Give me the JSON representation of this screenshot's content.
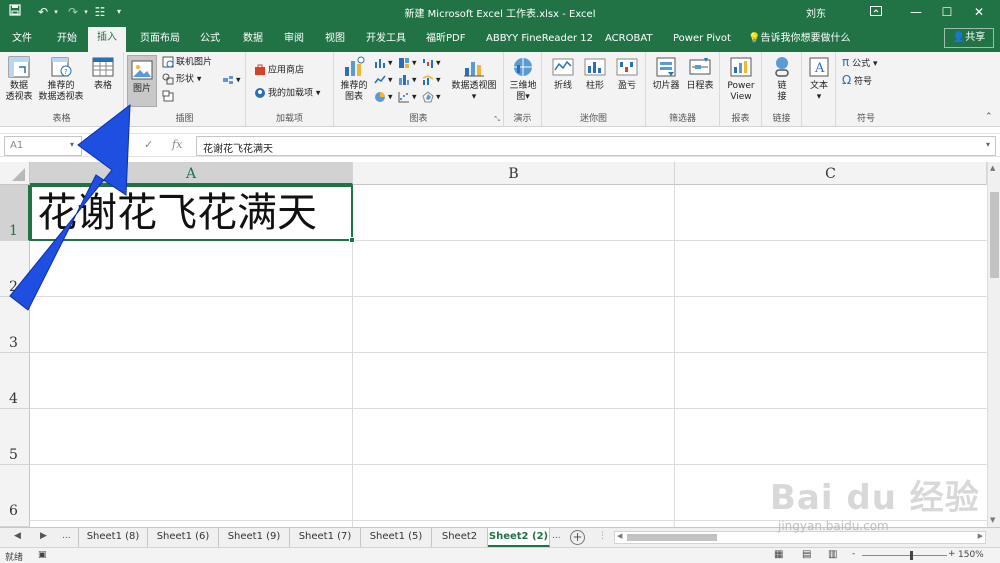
{
  "titlebar": {
    "save_icon": "save-icon",
    "undo_icon": "undo-icon",
    "redo_icon": "redo-icon",
    "title": "新建 Microsoft Excel 工作表.xlsx  -  Excel",
    "user": "刘东",
    "controls": [
      "ribbon-display-icon",
      "minimize-icon",
      "maximize-icon",
      "close-icon"
    ]
  },
  "tabs": [
    {
      "label": "文件"
    },
    {
      "label": "开始"
    },
    {
      "label": "插入",
      "active": true
    },
    {
      "label": "页面布局"
    },
    {
      "label": "公式"
    },
    {
      "label": "数据"
    },
    {
      "label": "审阅"
    },
    {
      "label": "视图"
    },
    {
      "label": "开发工具"
    },
    {
      "label": "福昕PDF"
    },
    {
      "label": "ABBYY FineReader 12"
    },
    {
      "label": "ACROBAT"
    },
    {
      "label": "Power Pivot"
    }
  ],
  "tell_me": "告诉我你想要做什么",
  "share": "共享",
  "ribbon": {
    "tables": {
      "label": "表格",
      "pivot": "数据\n透视表",
      "recommended_pivot": "推荐的\n数据透视表",
      "table": "表格"
    },
    "illustrations": {
      "label": "插图",
      "picture": "图片",
      "online_picture": "联机图片",
      "shapes": "形状"
    },
    "addins": {
      "label": "加载项",
      "store": "应用商店",
      "my_addins": "我的加载项"
    },
    "charts": {
      "label": "图表",
      "recommended": "推荐的\n图表",
      "pivot_chart": "数据透视图"
    },
    "tours": {
      "label": "演示",
      "map3d": "三维地\n图"
    },
    "sparklines": {
      "label": "迷你图",
      "line": "折线",
      "column": "柱形",
      "winloss": "盈亏"
    },
    "filters": {
      "label": "筛选器",
      "slicer": "切片器",
      "timeline": "日程表"
    },
    "reports": {
      "label": "报表",
      "powerview": "Power\nView"
    },
    "links": {
      "label": "链接",
      "link": "链\n接"
    },
    "text": {
      "label": "",
      "text": "文本"
    },
    "symbols": {
      "label": "符号",
      "equation": "公式",
      "symbol": "符号",
      "pi": "π",
      "omega": "Ω"
    }
  },
  "formula_bar": {
    "name_box": "A1",
    "cancel": "✕",
    "enter": "✓",
    "fx": "fx",
    "value": "花谢花飞花满天"
  },
  "grid": {
    "columns": [
      "A",
      "B",
      "C"
    ],
    "rows": [
      "1",
      "2",
      "3",
      "4",
      "5",
      "6"
    ],
    "a1": "花谢花飞花满天"
  },
  "sheets": {
    "ellipsis_left": "...",
    "tabs": [
      "Sheet1 (8)",
      "Sheet1 (6)",
      "Sheet1 (9)",
      "Sheet1 (7)",
      "Sheet1 (5)",
      "Sheet2",
      "Sheet2 (2)"
    ],
    "active": "Sheet2 (2)",
    "ellipsis_right": "..."
  },
  "status": {
    "ready": "就绪",
    "zoom": "150%",
    "zoom_minus": "-",
    "zoom_plus": "+"
  },
  "watermark": {
    "logo": "Bai du 经验",
    "url": "jingyan.baidu.com"
  },
  "colors": {
    "accent": "#217346",
    "arrow": "#1f4fe0"
  }
}
